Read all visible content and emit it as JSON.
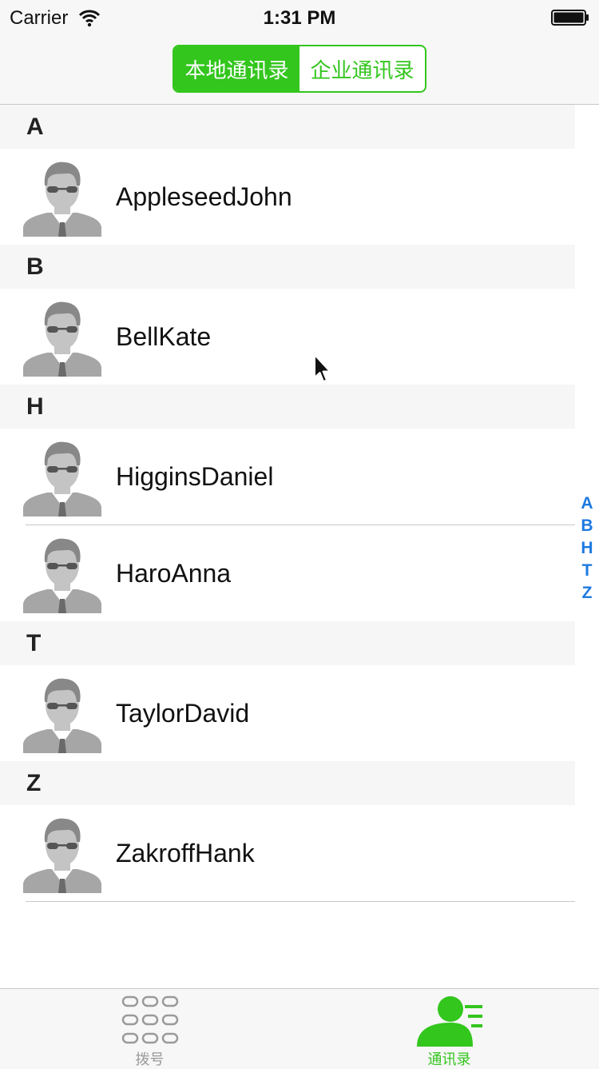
{
  "status_bar": {
    "carrier": "Carrier",
    "time": "1:31 PM"
  },
  "segmented": {
    "local": "本地通讯录",
    "enterprise": "企业通讯录",
    "selected": "local"
  },
  "sections": [
    {
      "letter": "A",
      "contacts": [
        "AppleseedJohn"
      ]
    },
    {
      "letter": "B",
      "contacts": [
        "BellKate"
      ]
    },
    {
      "letter": "H",
      "contacts": [
        "HigginsDaniel",
        "HaroAnna"
      ]
    },
    {
      "letter": "T",
      "contacts": [
        "TaylorDavid"
      ]
    },
    {
      "letter": "Z",
      "contacts": [
        "ZakroffHank"
      ]
    }
  ],
  "index": [
    "A",
    "B",
    "H",
    "T",
    "Z"
  ],
  "tabs": {
    "dial": "拨号",
    "contacts": "通讯录",
    "selected": "contacts"
  },
  "colors": {
    "accent": "#33c61d",
    "index": "#1e7ae0",
    "inactive_tab": "#9a9a9a"
  }
}
